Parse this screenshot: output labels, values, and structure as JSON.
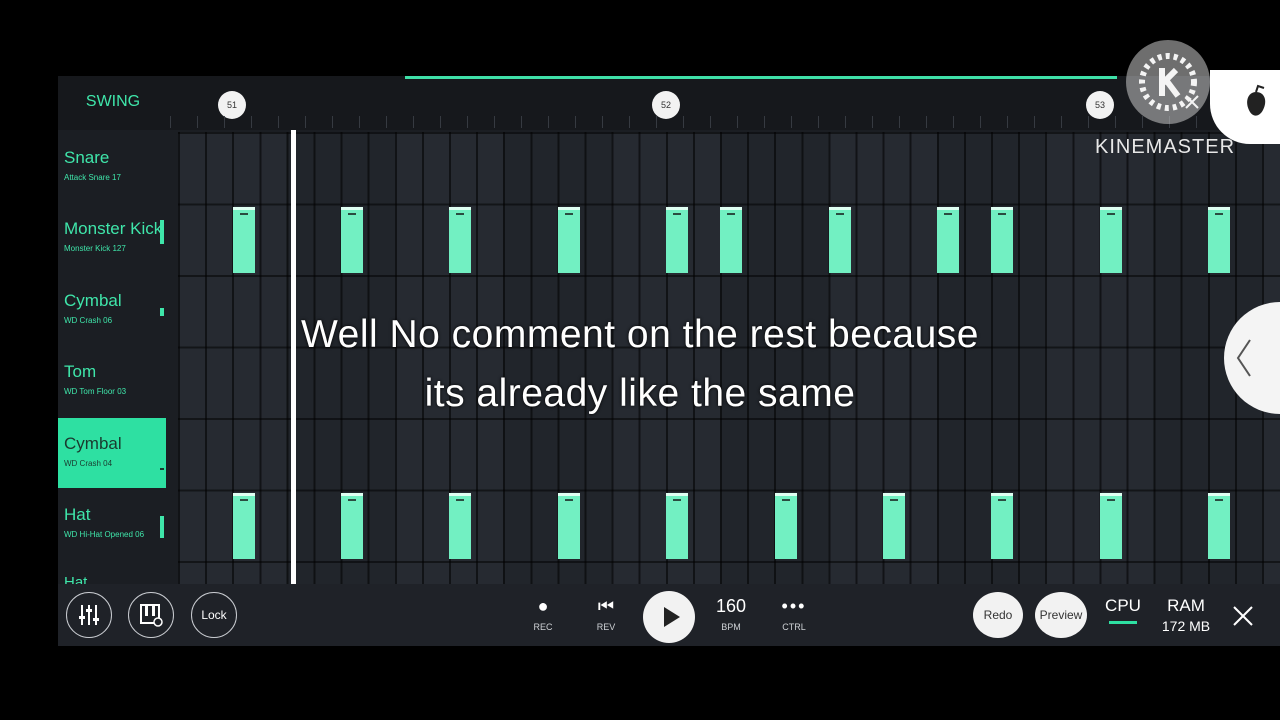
{
  "topbar": {
    "swing_label": "SWING",
    "bar_markers": [
      "51",
      "52",
      "53"
    ]
  },
  "tracks": [
    {
      "name": "Snare",
      "sample": "Attack Snare 17",
      "selected": false
    },
    {
      "name": "Monster Kick",
      "sample": "Monster Kick 127",
      "selected": false
    },
    {
      "name": "Cymbal",
      "sample": "WD Crash 06",
      "selected": false
    },
    {
      "name": "Tom",
      "sample": "WD Tom Floor 03",
      "selected": false
    },
    {
      "name": "Cymbal",
      "sample": "WD Crash 04",
      "selected": true
    },
    {
      "name": "Hat",
      "sample": "WD Hi-Hat Opened 06",
      "selected": false
    }
  ],
  "last_track_partial": "Hat",
  "pattern": {
    "monster_kick_steps": [
      2,
      6,
      10,
      14,
      18,
      20,
      24,
      28,
      30,
      34,
      38
    ],
    "hat_steps": [
      2,
      6,
      10,
      14,
      18,
      22,
      26,
      30,
      34,
      38
    ]
  },
  "subtitle": {
    "line1": "Well No comment on the rest because",
    "line2": "its already like the same"
  },
  "transport": {
    "lock_label": "Lock",
    "rec_label": "REC",
    "rev_label": "REV",
    "bpm_value": "160",
    "bpm_label": "BPM",
    "ctrl_label": "CTRL",
    "redo_label": "Redo",
    "preview_label": "Preview",
    "cpu_label": "CPU",
    "ram_label": "RAM",
    "ram_value": "172 MB"
  },
  "watermark": {
    "text": "KINEMASTER"
  },
  "colors": {
    "accent": "#3fe6aa",
    "note": "#72f0c2",
    "background": "#1b1e23"
  }
}
